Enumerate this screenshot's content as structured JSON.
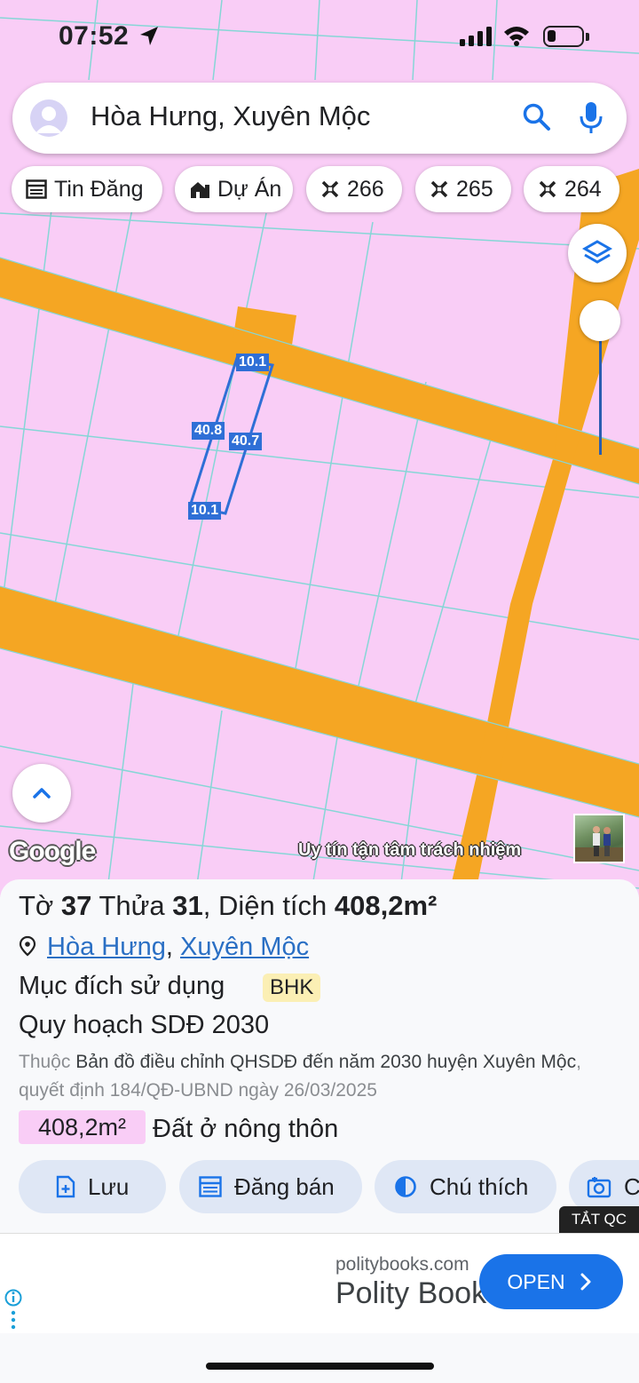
{
  "status_bar": {
    "time": "07:52"
  },
  "search": {
    "query": "Hòa Hưng, Xuyên Mộc"
  },
  "chips": [
    {
      "label": "Tin Đăng",
      "icon": "listing-icon"
    },
    {
      "label": "Dự Án",
      "icon": "buildings-icon"
    },
    {
      "label": "266",
      "icon": "plot-icon"
    },
    {
      "label": "265",
      "icon": "plot-icon"
    },
    {
      "label": "264",
      "icon": "plot-icon"
    }
  ],
  "map": {
    "dimensions": {
      "top": "10.1",
      "bottom": "10.1",
      "left": "40.8",
      "right": "40.7"
    },
    "zoom_level": 0.0,
    "attribution": "Google",
    "watermark": "Uy tín tận tâm trách nhiệm",
    "colors": {
      "land": "#f9cdf6",
      "road": "#f5a623",
      "parcel_line": "#7fd7d7",
      "plot_outline": "#2f6fd6"
    }
  },
  "parcel": {
    "title_prefix": "Tờ",
    "sheet": "37",
    "lot_prefix": "Thửa",
    "lot": "31",
    "area_prefix": ", Diện tích",
    "area": "408,2m²",
    "commune": "Hòa Hưng",
    "district": "Xuyên Mộc",
    "purpose_label": "Mục đích sử dụng",
    "purpose_code": "BHK",
    "plan_label": "Quy hoạch SDĐ 2030",
    "desc_prefix": "Thuộc",
    "desc_map": "Bản đồ điều chỉnh QHSDĐ đến năm 2030 huyện Xuyên Mộc",
    "desc_decision": ", quyết định 184/QĐ-UBND ngày 26/03/2025",
    "area_chip": "408,2m²",
    "land_type": "Đất ở nông thôn"
  },
  "actions": [
    {
      "label": "Lưu",
      "icon": "save-icon"
    },
    {
      "label": "Đăng bán",
      "icon": "post-icon"
    },
    {
      "label": "Chú thích",
      "icon": "legend-icon"
    },
    {
      "label": "C",
      "icon": "camera-icon"
    }
  ],
  "ad": {
    "close_label": "TẮT QC",
    "domain": "politybooks.com",
    "title": "Polity Books",
    "cta": "OPEN"
  }
}
